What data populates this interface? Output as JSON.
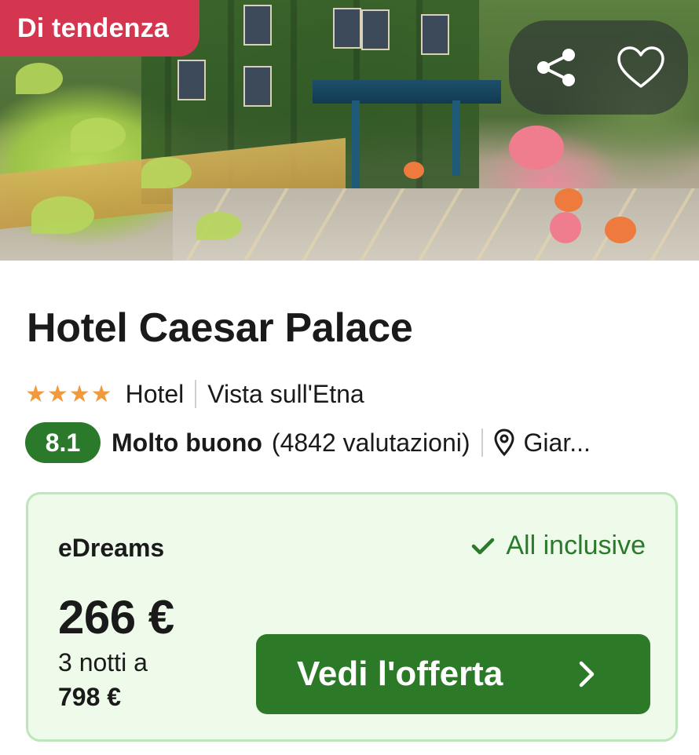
{
  "hero": {
    "badge": "Di tendenza",
    "share_icon": "share-icon",
    "favorite_icon": "heart-icon"
  },
  "hotel": {
    "name": "Hotel Caesar Palace",
    "stars": "★★★★",
    "star_count": 4,
    "type": "Hotel",
    "feature": "Vista sull'Etna"
  },
  "rating": {
    "score": "8.1",
    "label": "Molto buono",
    "reviews": "(4842 valutazioni)",
    "location_icon": "map-pin-icon",
    "location": "Giar..."
  },
  "offer": {
    "provider": "eDreams",
    "inclusive_icon": "checkmark-icon",
    "inclusive_label": "All inclusive",
    "price": "266 €",
    "nights_text": "3 notti a",
    "total": "798 €",
    "cta_label": "Vedi l'offerta",
    "cta_icon": "chevron-right-icon"
  },
  "colors": {
    "badge": "#d4354f",
    "stars": "#f29a3b",
    "score_bg": "#2b7a2b",
    "card_bg": "#eefaea",
    "card_border": "#bfe6bb",
    "cta_bg": "#2c7a28",
    "accent_green": "#2b7a2b"
  }
}
